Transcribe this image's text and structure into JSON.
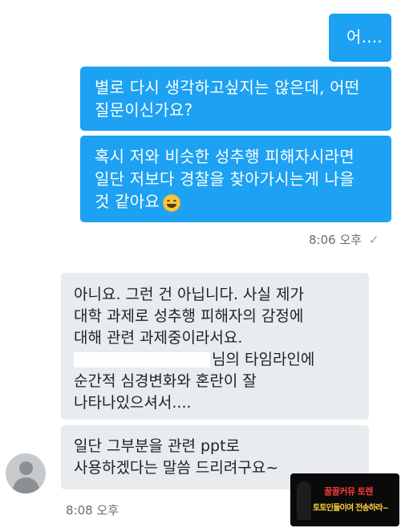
{
  "messages": {
    "out1": "어....",
    "out2": [
      "별로 다시 생각하고싶지는 않은데, 어떤",
      "질문이신가요?"
    ],
    "out3": [
      "혹시 저와 비슷한 성추행 피해자시라면",
      "일단 저보다 경찰을 찾아가시는게 나을",
      "것 같아요"
    ],
    "out_timestamp": "8:06 오후",
    "read_check": "✓",
    "in1": [
      "아니요. 그런 건 아닙니다. 사실 제가",
      "대학 과제로 성추행 피해자의 감정에",
      "대해 관련 과제중이라서요.",
      "님의 타임라인에",
      "순간적 심경변화와 혼란이 잘",
      "나타나있으셔서...."
    ],
    "in2": [
      "일단 그부분을 관련 ppt로",
      "사용하겠다는 말씀 드리려구요~"
    ],
    "in_timestamp": "8:08 오후"
  },
  "icons": {
    "emoji": "grinning-face",
    "avatar": "default-profile"
  },
  "watermark": {
    "top": "꿀꿀커뮤 토렌",
    "bottom": "토토인들이여 전송하라~"
  },
  "colors": {
    "outgoing_bubble": "#1da1f2",
    "incoming_bubble": "#e9ecef",
    "timestamp": "#6b6b6b"
  }
}
